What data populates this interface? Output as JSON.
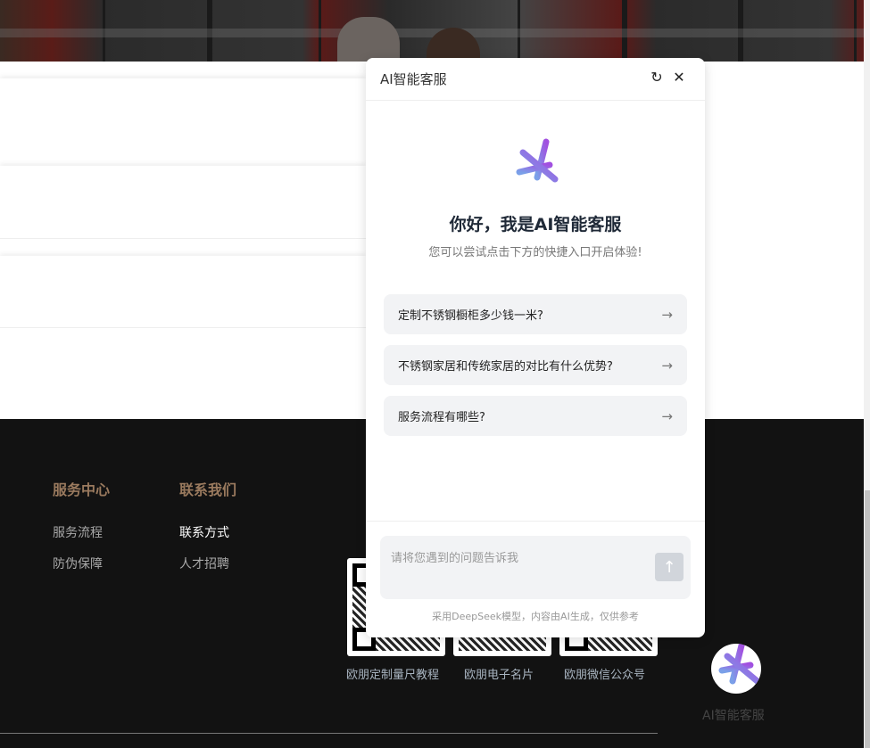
{
  "chat": {
    "title": "AI智能客服",
    "greeting": "你好，我是AI智能客服",
    "subtitle": "您可以尝试点击下方的快捷入口开启体验!",
    "quick_questions": [
      "定制不锈钢橱柜多少钱一米?",
      "不锈钢家居和传统家居的对比有什么优势?",
      "服务流程有哪些?"
    ],
    "input_placeholder": "请将您遇到的问题告诉我",
    "disclaimer": "采用DeepSeek模型，内容由AI生成，仅供参考"
  },
  "footer": {
    "columns": [
      {
        "title": "服务中心",
        "links": [
          "服务流程",
          "防伪保障"
        ]
      },
      {
        "title": "联系我们",
        "links": [
          "联系方式",
          "人才招聘"
        ]
      }
    ],
    "qr_codes": [
      "欧朋定制量尺教程",
      "欧朋电子名片",
      "欧朋微信公众号"
    ]
  },
  "float_button": {
    "label": "AI智能客服"
  },
  "colors": {
    "footer_bg": "#121212",
    "footer_title": "#9a7a5e",
    "accent_gradient_start": "#7aa0e8",
    "accent_gradient_end": "#a24fe0"
  }
}
